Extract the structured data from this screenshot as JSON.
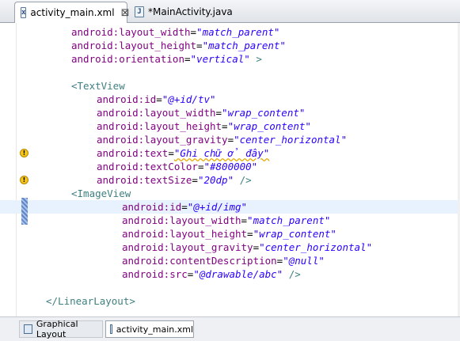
{
  "tabs": [
    {
      "label": "activity_main.xml",
      "icon": "xml-file-icon",
      "close": "⊠",
      "active": true
    },
    {
      "label": "*MainActivity.java",
      "icon": "java-file-icon",
      "active": false
    }
  ],
  "code": [
    {
      "indent": 2,
      "attr": "android:layout_width",
      "value": "\"match_parent\""
    },
    {
      "indent": 2,
      "attr": "android:layout_height",
      "value": "\"match_parent\""
    },
    {
      "indent": 2,
      "attr": "android:orientation",
      "value": "\"vertical\"",
      "suffix": " >"
    },
    {
      "indent": 0,
      "blank": true
    },
    {
      "indent": 2,
      "tag": "<TextView"
    },
    {
      "indent": 4,
      "attr": "android:id",
      "value": "\"@+id/tv\""
    },
    {
      "indent": 4,
      "attr": "android:layout_width",
      "value": "\"wrap_content\""
    },
    {
      "indent": 4,
      "attr": "android:layout_height",
      "value": "\"wrap_content\""
    },
    {
      "indent": 4,
      "attr": "android:layout_gravity",
      "value": "\"center_horizontal\""
    },
    {
      "indent": 4,
      "attr": "android:text",
      "value": "\"Ghi chữ ở đây\"",
      "warn": true,
      "squiggle": true
    },
    {
      "indent": 4,
      "attr": "android:textColor",
      "value": "\"#800000\""
    },
    {
      "indent": 4,
      "attr": "android:textSize",
      "value": "\"20dp\"",
      "suffix": " />",
      "warn": true
    },
    {
      "indent": 2,
      "tag": "<ImageView"
    },
    {
      "indent": 6,
      "attr": "android:id",
      "value": "\"@+id/img\"",
      "current": true
    },
    {
      "indent": 6,
      "attr": "android:layout_width",
      "value": "\"match_parent\""
    },
    {
      "indent": 6,
      "attr": "android:layout_height",
      "value": "\"wrap_content\""
    },
    {
      "indent": 6,
      "attr": "android:layout_gravity",
      "value": "\"center_horizontal\""
    },
    {
      "indent": 6,
      "attr": "android:contentDescription",
      "value": "\"@null\""
    },
    {
      "indent": 6,
      "attr": "android:src",
      "value": "\"@drawable/abc\"",
      "suffix": " />"
    },
    {
      "indent": 0,
      "blank": true
    },
    {
      "indent": 0,
      "tag": "</LinearLayout>"
    }
  ],
  "bottom_tabs": [
    {
      "label": "Graphical Layout",
      "icon": "layout-icon"
    },
    {
      "label": "activity_main.xml",
      "icon": "xml-source-icon"
    }
  ],
  "colors": {
    "attribute": "#7f007f",
    "value": "#2a00ff",
    "tag": "#3f7f7f",
    "warning": "#f5c518",
    "current_line": "#e8f2fe"
  }
}
